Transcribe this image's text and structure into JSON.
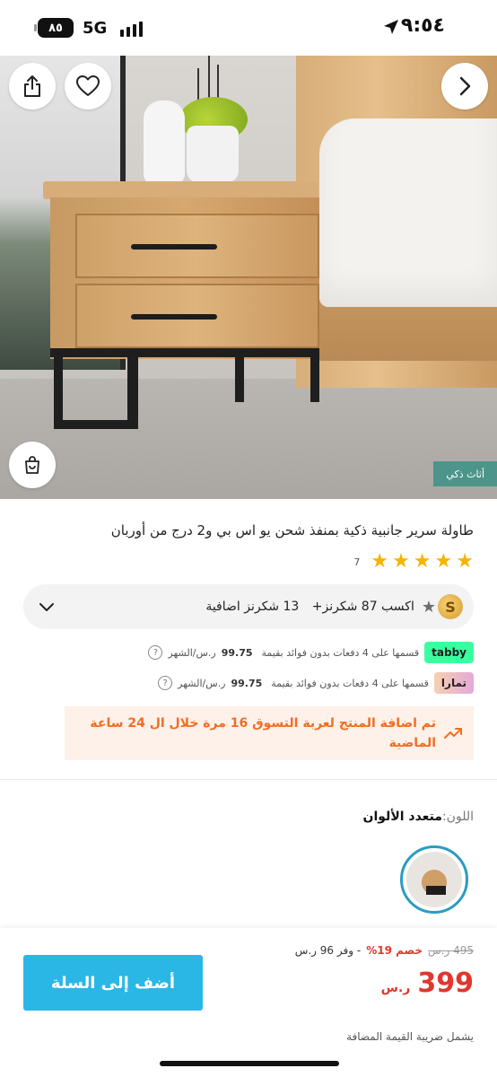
{
  "status_bar": {
    "time": "٩:٥٤",
    "network": "5G",
    "battery": "٨٥"
  },
  "hero": {
    "category_badge": "أثاث ذكي",
    "gallery_progress": 0.1,
    "icons": [
      "share-icon",
      "heart-icon",
      "chevron-right-icon",
      "cart-icon"
    ]
  },
  "product": {
    "title": "طاولة سرير جانبية ذكية بمنفذ شحن يو اس بي و2 درج من أوربان",
    "rating": 5,
    "rating_count": "7"
  },
  "points": {
    "coin_letter": "S",
    "main_text": "اكسب 87 شكرنز+",
    "extra_text": "13 شكرنز اضافية"
  },
  "installments": [
    {
      "provider": "tabby",
      "text": "قسمها على 4 دفعات بدون فوائد بقيمة",
      "amount": "99.75",
      "unit": "ر.س/الشهر"
    },
    {
      "provider": "تمارا",
      "text": "قسمها على 4 دفعات بدون فوائد بقيمة",
      "amount": "99.75",
      "unit": "ر.س/الشهر"
    }
  ],
  "alert": {
    "text": "تم اضافة المنتج لعربة التسوق 16 مرة خلال ال 24 ساعة الماضية"
  },
  "color": {
    "label": "اللون:",
    "value": "متعدد الألوان"
  },
  "bottom": {
    "add_button": "أضف إلى السلة",
    "old_price": "495",
    "old_currency": "ر.س",
    "discount": "خصم 19%",
    "save_text": "- وفر 96 ر.س",
    "price": "399",
    "currency": "ر.س",
    "vat_note": "يشمل ضريبة القيمة المضافة"
  },
  "colors": {
    "accent_blue": "#2bb7e6",
    "price_red": "#e2362f",
    "alert_orange": "#f26d21",
    "badge_teal": "#4d958a"
  }
}
